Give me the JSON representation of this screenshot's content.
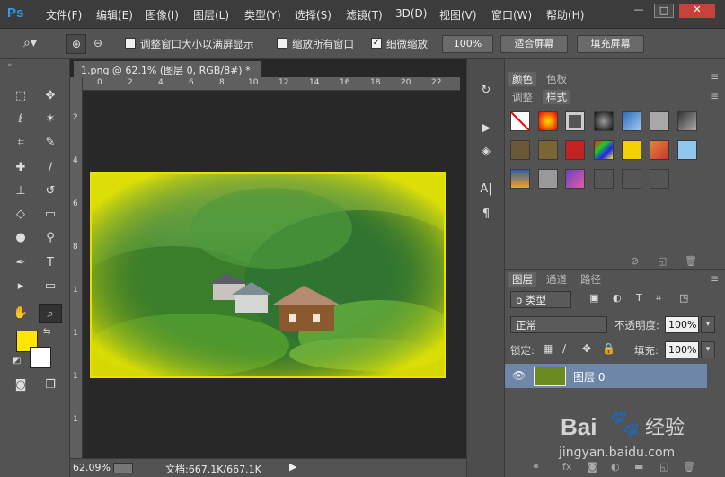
{
  "app": {
    "logo": "Ps"
  },
  "menu": [
    "文件(F)",
    "编辑(E)",
    "图像(I)",
    "图层(L)",
    "类型(Y)",
    "选择(S)",
    "滤镜(T)",
    "3D(D)",
    "视图(V)",
    "窗口(W)",
    "帮助(H)"
  ],
  "window_controls": {
    "minimize": "—",
    "maximize": "□",
    "close": "✕"
  },
  "options": {
    "resize_windows_label": "调整窗口大小以满屏显示",
    "zoom_all_windows_label": "缩放所有窗口",
    "scrubby_zoom_label": "细微缩放",
    "zoom_100_button": "100%",
    "fit_screen_button": "适合屏幕",
    "fill_screen_button": "填充屏幕",
    "scrubby_zoom_checked": true
  },
  "document": {
    "tab_title": "1.png @ 62.1% (图层 0, RGB/8#) *",
    "tab_close": "×",
    "ruler_top_ticks": [
      "0",
      "2",
      "4",
      "6",
      "8",
      "10",
      "12",
      "14",
      "16",
      "18",
      "20",
      "22"
    ],
    "ruler_left_ticks": [
      "2",
      "4",
      "6",
      "8",
      "1",
      "1",
      "1",
      "1"
    ]
  },
  "status": {
    "zoom": "62.09%",
    "doc_info": "文档:667.1K/667.1K"
  },
  "colors": {
    "foreground": "#ffe500",
    "background": "#ffffff",
    "accent": "#2f9de8",
    "image_border": "#e7e000",
    "layer_selected": "#6e87a8"
  },
  "panels": {
    "color_tabs": [
      "颜色",
      "色板"
    ],
    "style_tabs": [
      "调整",
      "样式"
    ],
    "layer_tabs": [
      "图层",
      "通道",
      "路径"
    ],
    "filter_kind": "ρ 类型",
    "blend_mode": "正常",
    "opacity_label": "不透明度:",
    "opacity_value": "100%",
    "lock_label": "锁定:",
    "fill_label": "填充:",
    "fill_value": "100%",
    "layer_name": "图层 0",
    "footer_fx": "fx"
  },
  "watermark": {
    "brand": "Bai",
    "brand2": "经验",
    "url": "jingyan.baidu.com"
  }
}
